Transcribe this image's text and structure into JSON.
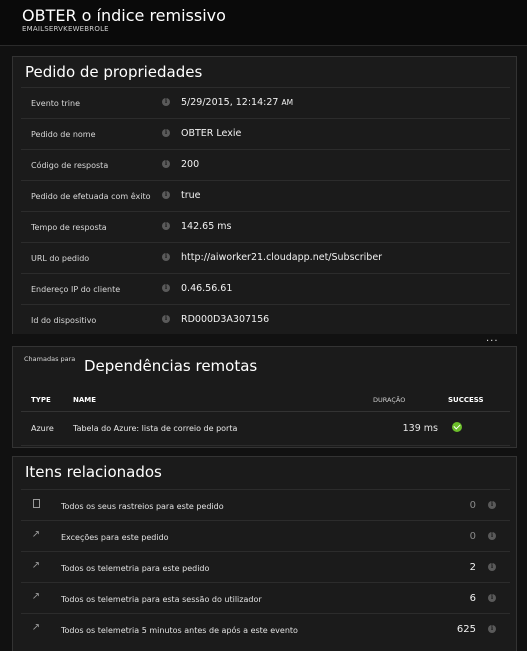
{
  "header": {
    "title": "OBTER o índice remissivo",
    "subtitle": "EMAILSERVKEWEBROLE"
  },
  "properties": {
    "title": "Pedido de propriedades",
    "info_icon": "info-icon",
    "rows": [
      {
        "label": "Evento trine",
        "value": "5/29/2015, 12:14:27",
        "suffix": "AM"
      },
      {
        "label": "Pedido de nome",
        "value": "OBTER Lexie"
      },
      {
        "label": "Código de resposta",
        "value": "200"
      },
      {
        "label": "Pedido de efetuada com êxito",
        "value": "true"
      },
      {
        "label": "Tempo de resposta",
        "value": "142.65 ms"
      },
      {
        "label": "URL do pedido",
        "value": "http://aiworker21.cloudapp.net/Subscriber"
      },
      {
        "label": "Endereço IP do cliente",
        "value": "0.46.56.61"
      },
      {
        "label": "Id do dispositivo",
        "value": "RD000D3A307156"
      }
    ],
    "more_label": "..."
  },
  "dependencies": {
    "side_label": "Chamadas para",
    "title": "Dependências remotas",
    "columns": {
      "type": "TYPE",
      "name": "NAME",
      "duration": "DURAÇÃO",
      "success": "SUCCESS"
    },
    "rows": [
      {
        "type": "Azure",
        "name": "Tabela do Azure: lista de correio de porta",
        "duration": "139 ms",
        "success_icon": "success-check-icon"
      }
    ]
  },
  "related": {
    "title": "Itens relacionados",
    "items": [
      {
        "icon": "document-icon",
        "label": "Todos os seus rastreios para este pedido",
        "count": "0"
      },
      {
        "icon": "arrow-link-icon",
        "label": "Exceções para este pedido",
        "count": "0"
      },
      {
        "icon": "arrow-link-icon",
        "label": "Todos os telemetria para este pedido",
        "count": "2"
      },
      {
        "icon": "arrow-link-icon",
        "label": "Todos os telemetria para esta sessão do utilizador",
        "count": "6"
      },
      {
        "icon": "arrow-link-icon",
        "label": "Todos os telemetria 5 minutos antes de após a este evento",
        "count": "625"
      }
    ]
  },
  "colors": {
    "background": "#111111",
    "panel": "#1b1b1b",
    "success": "#6cbf2a"
  }
}
